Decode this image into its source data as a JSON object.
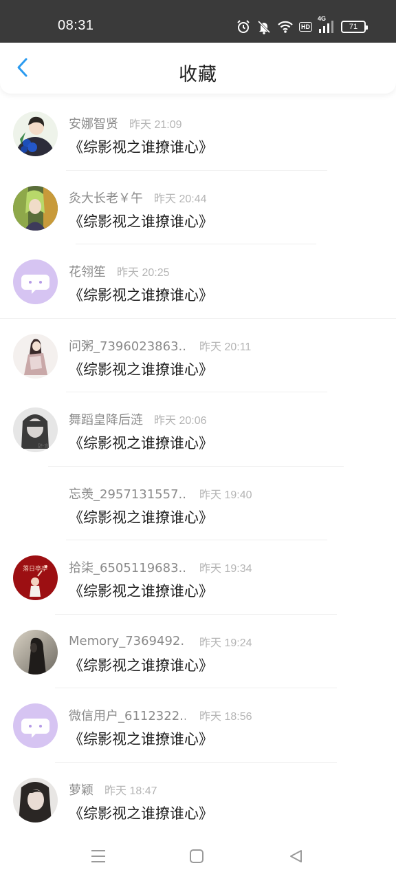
{
  "status_bar": {
    "time": "08:31",
    "icons": [
      "alarm-icon",
      "mute-icon",
      "wifi-icon",
      "hd-icon",
      "signal-4g-icon",
      "battery-icon"
    ],
    "hd_label": "HD",
    "network_label": "4G",
    "battery_level": "71"
  },
  "header": {
    "title": "收藏",
    "back_icon": "chevron-left-icon",
    "accent_color": "#2b9bf0"
  },
  "items": [
    {
      "username": "安娜智贤",
      "time": "昨天 21:09",
      "content": "《综影视之谁撩谁心》",
      "avatar": "anime-boy-blue-roses"
    },
    {
      "username": "灸大长老￥午",
      "time": "昨天 20:44",
      "content": "《综影视之谁撩谁心》",
      "avatar": "anime-green-hair"
    },
    {
      "username": "花翎笙",
      "time": "昨天 20:25",
      "content": "《综影视之谁撩谁心》",
      "avatar": "default-chat-icon"
    },
    {
      "username": "问粥_7396023863...",
      "time": "昨天 20:11",
      "content": "《综影视之谁撩谁心》",
      "avatar": "girl-hanfu"
    },
    {
      "username": "舞蹈皇降后涟",
      "time": "昨天 20:06",
      "content": "《综影视之谁撩谁心》",
      "avatar": "girl-grayscale"
    },
    {
      "username": "忘羡_2957131557...",
      "time": "昨天 19:40",
      "content": "《综影视之谁撩谁心》",
      "avatar": "none"
    },
    {
      "username": "拾柒_6505119683...",
      "time": "昨天 19:34",
      "content": "《综影视之谁撩谁心》",
      "avatar": "red-illustration"
    },
    {
      "username": "Memory_7369492...",
      "time": "昨天 19:24",
      "content": "《综影视之谁撩谁心》",
      "avatar": "girl-silhouette"
    },
    {
      "username": "微信用户_6112322...",
      "time": "昨天 18:56",
      "content": "《综影视之谁撩谁心》",
      "avatar": "default-chat-icon"
    },
    {
      "username": "萝颖",
      "time": "昨天 18:47",
      "content": "《综影视之谁撩谁心》",
      "avatar": "girl-portrait"
    }
  ],
  "nav_bar": {
    "icons": [
      "menu-icon",
      "home-icon",
      "back-triangle-icon"
    ]
  }
}
